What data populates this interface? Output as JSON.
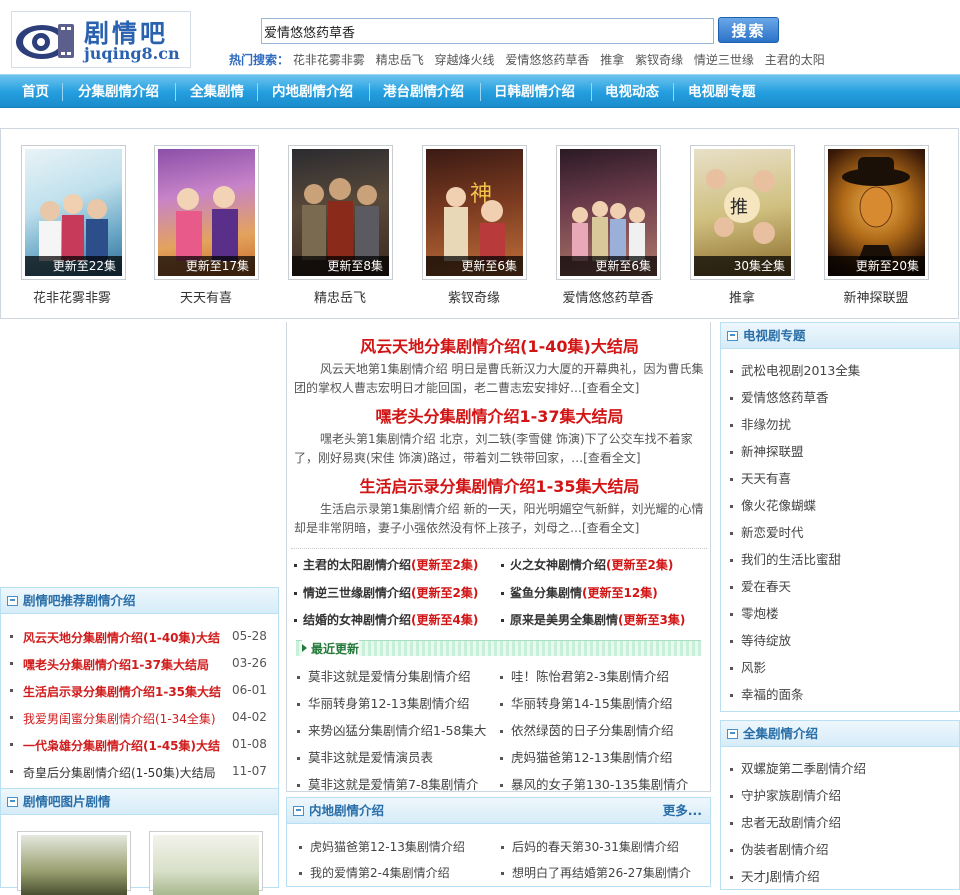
{
  "header": {
    "logo_cn": "剧情吧",
    "logo_en": "juqing8.cn",
    "search_value": "爱情悠悠药草香",
    "search_button": "搜索",
    "hot_label": "热门搜索：",
    "hot_terms": [
      "花非花雾非雾",
      "精忠岳飞",
      "穿越烽火线",
      "爱情悠悠药草香",
      "推拿",
      "紫钗奇缘",
      "情逆三世缘",
      "主君的太阳"
    ]
  },
  "nav": [
    "首页",
    "分集剧情介绍",
    "全集剧情",
    "内地剧情介绍",
    "港台剧情介绍",
    "日韩剧情介绍",
    "电视动态",
    "电视剧专题"
  ],
  "posters": [
    {
      "title": "花非花雾非雾",
      "caption": "更新至22集"
    },
    {
      "title": "天天有喜",
      "caption": "更新至17集"
    },
    {
      "title": "精忠岳飞",
      "caption": "更新至8集"
    },
    {
      "title": "紫钗奇缘",
      "caption": "更新至6集"
    },
    {
      "title": "爱情悠悠药草香",
      "caption": "更新至6集"
    },
    {
      "title": "推拿",
      "caption": "30集全集"
    },
    {
      "title": "新神探联盟",
      "caption": "更新至20集"
    }
  ],
  "featured": [
    {
      "title": "风云天地分集剧情介绍(1-40集)大结局",
      "desc": "风云天地第1集剧情介绍 明日是曹氏新汉力大厦的开幕典礼，因为曹氏集团的掌权人曹志宏明日才能回国，老二曹志宏安排好…[查看全文]"
    },
    {
      "title": "嘿老头分集剧情介绍1-37集大结局",
      "desc": "嘿老头第1集剧情介绍 北京，刘二轶(李雪健 饰演)下了公交车找不着家了，刚好易爽(宋佳 饰演)路过，带着刘二铁带回家，…[查看全文]"
    },
    {
      "title": "生活启示录分集剧情介绍1-35集大结局",
      "desc": "生活启示录第1集剧情介绍 新的一天，阳光明媚空气新鲜，刘光耀的心情却是非常阴暗，妻子小强依然没有怀上孩子，刘母之…[查看全文]"
    }
  ],
  "headlines": [
    {
      "name": "主君的太阳剧情介绍",
      "upd": "(更新至2集)"
    },
    {
      "name": "火之女神剧情介绍",
      "upd": "(更新至2集)"
    },
    {
      "name": "情逆三世缘剧情介绍",
      "upd": "(更新至2集)"
    },
    {
      "name": "鲨鱼分集剧情",
      "upd": "(更新至12集)"
    },
    {
      "name": "结婚的女神剧情介绍",
      "upd": "(更新至4集)"
    },
    {
      "name": "原来是美男全集剧情",
      "upd": "(更新至3集)"
    }
  ],
  "latest": {
    "label": "最近更新",
    "items": [
      "莫非这就是爱情分集剧情介绍",
      "哇！陈怡君第2-3集剧情介绍",
      "华丽转身第12-13集剧情介绍",
      "华丽转身第14-15集剧情介绍",
      "来势凶猛分集剧情介绍1-58集大",
      "依然绿茵的日子分集剧情介绍",
      "莫非这就是爱情演员表",
      "虎妈猫爸第12-13集剧情介绍",
      "莫非这就是爱情第7-8集剧情介",
      "暴风的女子第130-135集剧情介"
    ]
  },
  "left_recommend": {
    "title": "剧情吧推荐剧情介绍",
    "items": [
      {
        "text": "风云天地分集剧情介绍(1-40集)大结",
        "date": "05-28"
      },
      {
        "text": "嘿老头分集剧情介绍1-37集大结局",
        "date": "03-26"
      },
      {
        "text": "生活启示录分集剧情介绍1-35集大结",
        "date": "06-01"
      },
      {
        "text": "我爱男闺蜜分集剧情介绍(1-34全集)",
        "date": "04-02"
      },
      {
        "text": "一代枭雄分集剧情介绍(1-45集)大结",
        "date": "01-08"
      },
      {
        "text": "奇皇后分集剧情介绍(1-50集)大结局",
        "date": "11-07"
      }
    ]
  },
  "left_pics": {
    "title": "剧情吧图片剧情"
  },
  "mainland": {
    "title": "内地剧情介绍",
    "more": "更多...",
    "items": [
      "虎妈猫爸第12-13集剧情介绍",
      "后妈的春天第30-31集剧情介绍",
      "我的爱情第2-4集剧情介绍",
      "想明白了再结婚第26-27集剧情介"
    ]
  },
  "right_topics": {
    "title": "电视剧专题",
    "items": [
      "武松电视剧2013全集",
      "爱情悠悠药草香",
      "非缘勿扰",
      "新神探联盟",
      "天天有喜",
      "像火花像蝴蝶",
      "新恋爱时代",
      "我们的生活比蜜甜",
      "爱在春天",
      "零炮楼",
      "等待绽放",
      "风影",
      "幸福的面条"
    ]
  },
  "right_full": {
    "title": "全集剧情介绍",
    "items": [
      "双螺旋第二季剧情介绍",
      "守护家族剧情介绍",
      "忠者无敌剧情介绍",
      "伪装者剧情介绍",
      "天才J剧情介绍"
    ]
  }
}
